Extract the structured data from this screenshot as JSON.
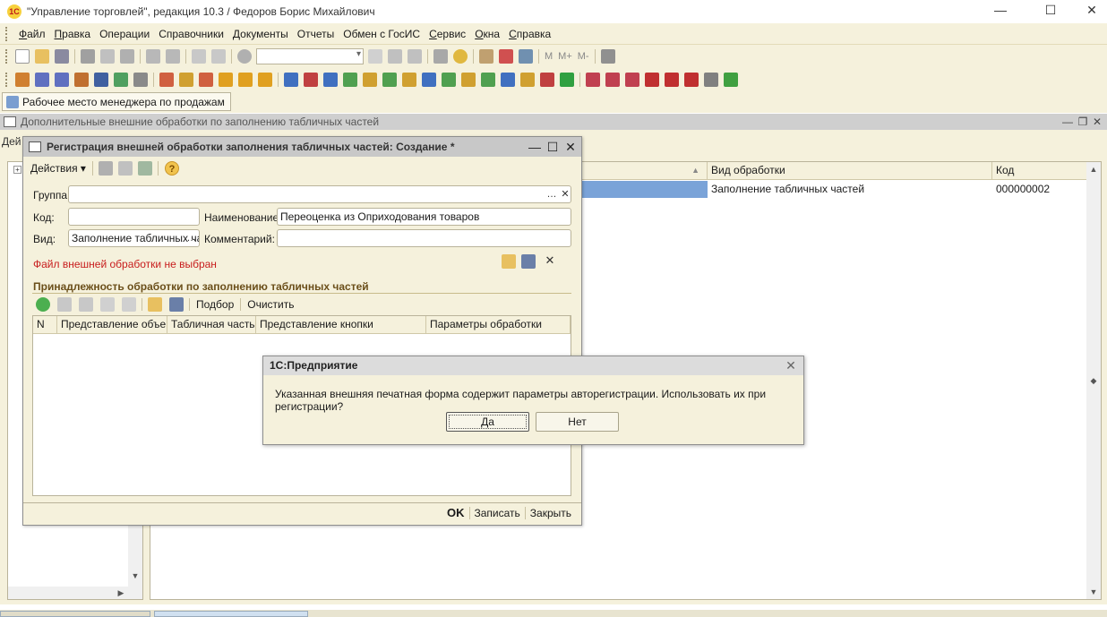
{
  "window": {
    "title": "\"Управление торговлей\", редакция 10.3 / Федоров Борис Михайлович",
    "logo_text": "1С",
    "minimize": "—",
    "maximize": "☐",
    "close": "✕"
  },
  "menu": {
    "items": [
      {
        "hot": "Ф",
        "rest": "айл"
      },
      {
        "hot": "П",
        "rest": "равка"
      },
      {
        "hot": "",
        "rest": "Операции"
      },
      {
        "hot": "",
        "rest": "Справочники"
      },
      {
        "hot": "",
        "rest": "Документы"
      },
      {
        "hot": "",
        "rest": "Отчеты"
      },
      {
        "hot": "",
        "rest": "Обмен с ГосИС"
      },
      {
        "hot": "С",
        "rest": "ервис"
      },
      {
        "hot": "О",
        "rest": "кна"
      },
      {
        "hot": "С",
        "rest": "правка"
      }
    ]
  },
  "toolbar": {
    "m_labels": [
      "M",
      "M+",
      "M-"
    ]
  },
  "panel": {
    "workplace_label": "Рабочее место менеджера по продажам"
  },
  "background_window": {
    "title": "Дополнительные внешние обработки по заполнению табличных частей",
    "actions_label": "Дей",
    "tree_expand": "+",
    "columns": [
      "Вид обработки",
      "Код"
    ],
    "row": {
      "kind": "Заполнение табличных частей",
      "code": "000000002"
    }
  },
  "form": {
    "title": "Регистрация внешней обработки заполнения табличных частей: Создание *",
    "actions_label": "Действия",
    "help_glyph": "?",
    "group_label": "Группа:",
    "group_value": "",
    "code_label": "Код:",
    "code_value": "",
    "name_label": "Наименование:",
    "name_value": "Переоценка из Оприходования товаров",
    "kind_label": "Вид:",
    "kind_value": "Заполнение табличных ча",
    "comment_label": "Комментарий:",
    "comment_value": "",
    "file_status": "Файл внешней обработки не выбран",
    "section_title": "Принадлежность обработки по заполнению табличных частей",
    "select_label": "Подбор",
    "clear_label": "Очистить",
    "columns": [
      "N",
      "Представление объе...",
      "Табличная часть",
      "Представление кнопки",
      "Параметры обработки"
    ],
    "ok_label": "OK",
    "save_label": "Записать",
    "close_label": "Закрыть"
  },
  "dialog": {
    "title": "1С:Предприятие",
    "message": "Указанная внешняя печатная форма содержит параметры авторегистрации. Использовать их при регистрации?",
    "yes_label": "Да",
    "no_label": "Нет"
  },
  "colors": {
    "accent_panel": "#f5f1dc",
    "selected_row": "#7aa3d8",
    "error_text": "#c81d1d",
    "section_text": "#6b4f1a"
  }
}
